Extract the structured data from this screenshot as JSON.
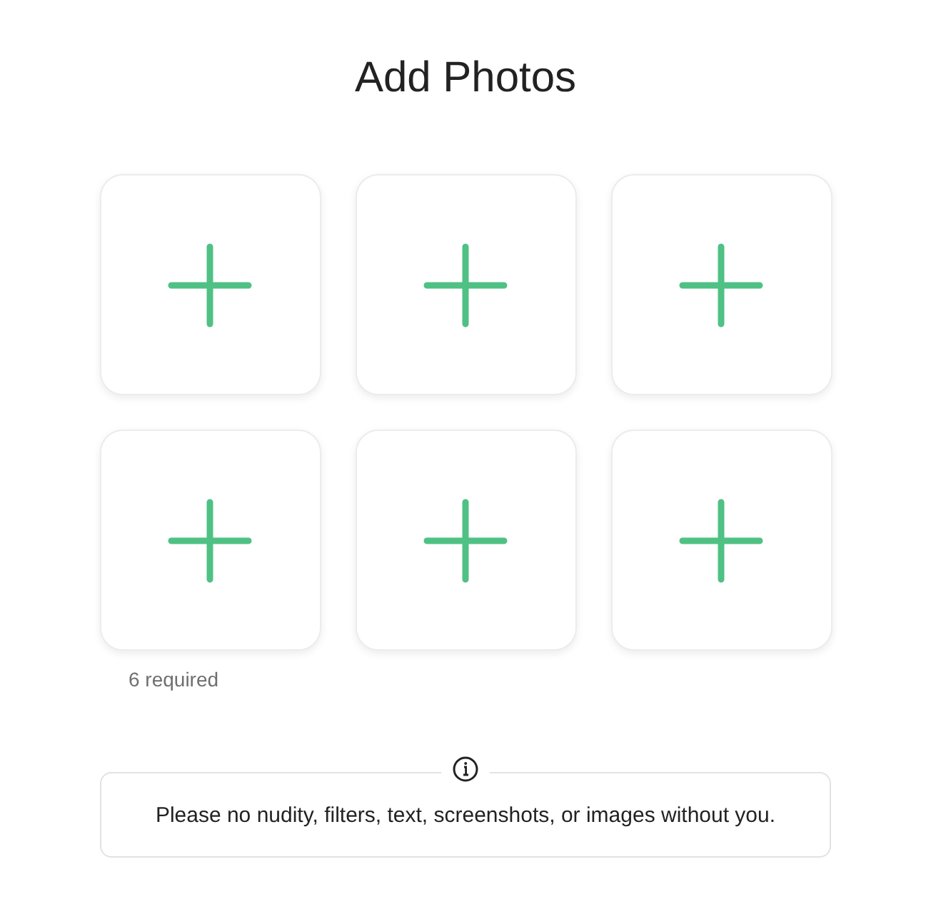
{
  "title": "Add Photos",
  "slots": [
    {
      "kind": "empty"
    },
    {
      "kind": "empty"
    },
    {
      "kind": "empty"
    },
    {
      "kind": "empty"
    },
    {
      "kind": "empty"
    },
    {
      "kind": "empty"
    }
  ],
  "requirement": "6 required",
  "notice": "Please no nudity, filters, text, screenshots, or images without you."
}
